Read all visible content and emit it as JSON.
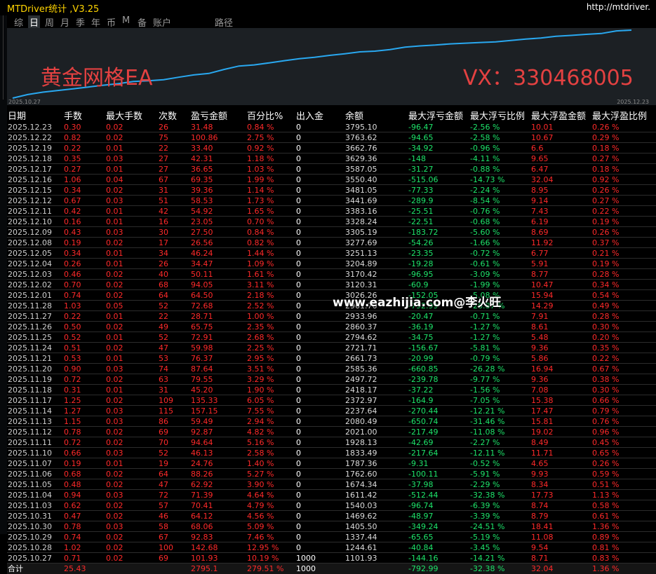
{
  "app": {
    "title": "MTDriver统计 ,V3.25",
    "url": "http://mtdriver."
  },
  "tabs": [
    "综",
    "日",
    "周",
    "月",
    "季",
    "年",
    "币",
    "M",
    "备",
    "账户",
    "路径"
  ],
  "active_tab": "日",
  "chart": {
    "watermark_left": "黄金网格EA",
    "watermark_right": "VX：330468005",
    "start_label": "2025.10.27",
    "end_label": "2025.12.23",
    "line_color": "#29a8f0",
    "equity": [
      1101.93,
      1244.61,
      1337.44,
      1405.5,
      1469.62,
      1540.03,
      1611.42,
      1674.34,
      1762.6,
      1787.36,
      1833.49,
      1928.13,
      2021.0,
      2080.49,
      2237.64,
      2372.97,
      2418.17,
      2497.72,
      2585.36,
      2661.73,
      2721.71,
      2794.62,
      2860.37,
      2933.96,
      2961.76,
      3026.26,
      3120.31,
      3170.42,
      3204.89,
      3251.13,
      3277.69,
      3305.19,
      3328.24,
      3383.16,
      3441.69,
      3481.05,
      3550.4,
      3587.05,
      3629.36,
      3662.76,
      3763.62,
      3795.1
    ]
  },
  "center_watermark": "www.eazhijia.com@李火旺",
  "table": {
    "headers": [
      "日期",
      "手数",
      "最大手数",
      "次数",
      "盈亏金额",
      "百分比%",
      "出入金",
      "余额",
      "最大浮亏金额",
      "最大浮亏比例",
      "最大浮盈金额",
      "最大浮盈比例"
    ],
    "rows": [
      [
        "2025.12.23",
        "0.30",
        "0.02",
        "26",
        "31.48",
        "0.84 %",
        "0",
        "3795.10",
        "-96.47",
        "-2.56 %",
        "10.01",
        "0.26 %"
      ],
      [
        "2025.12.22",
        "0.82",
        "0.02",
        "75",
        "100.86",
        "2.75 %",
        "0",
        "3763.62",
        "-94.65",
        "-2.58 %",
        "10.67",
        "0.29 %"
      ],
      [
        "2025.12.19",
        "0.22",
        "0.01",
        "22",
        "33.40",
        "0.92 %",
        "0",
        "3662.76",
        "-34.92",
        "-0.96 %",
        "6.6",
        "0.18 %"
      ],
      [
        "2025.12.18",
        "0.35",
        "0.03",
        "27",
        "42.31",
        "1.18 %",
        "0",
        "3629.36",
        "-148",
        "-4.11 %",
        "9.65",
        "0.27 %"
      ],
      [
        "2025.12.17",
        "0.27",
        "0.01",
        "27",
        "36.65",
        "1.03 %",
        "0",
        "3587.05",
        "-31.27",
        "-0.88 %",
        "6.47",
        "0.18 %"
      ],
      [
        "2025.12.16",
        "1.06",
        "0.04",
        "67",
        "69.35",
        "1.99 %",
        "0",
        "3550.40",
        "-515.06",
        "-14.73 %",
        "32.04",
        "0.92 %"
      ],
      [
        "2025.12.15",
        "0.34",
        "0.02",
        "31",
        "39.36",
        "1.14 %",
        "0",
        "3481.05",
        "-77.33",
        "-2.24 %",
        "8.95",
        "0.26 %"
      ],
      [
        "2025.12.12",
        "0.67",
        "0.03",
        "51",
        "58.53",
        "1.73 %",
        "0",
        "3441.69",
        "-289.9",
        "-8.54 %",
        "9.14",
        "0.27 %"
      ],
      [
        "2025.12.11",
        "0.42",
        "0.01",
        "42",
        "54.92",
        "1.65 %",
        "0",
        "3383.16",
        "-25.51",
        "-0.76 %",
        "7.43",
        "0.22 %"
      ],
      [
        "2025.12.10",
        "0.16",
        "0.01",
        "16",
        "23.05",
        "0.70 %",
        "0",
        "3328.24",
        "-22.51",
        "-0.68 %",
        "6.19",
        "0.19 %"
      ],
      [
        "2025.12.09",
        "0.43",
        "0.03",
        "30",
        "27.50",
        "0.84 %",
        "0",
        "3305.19",
        "-183.72",
        "-5.60 %",
        "8.69",
        "0.26 %"
      ],
      [
        "2025.12.08",
        "0.19",
        "0.02",
        "17",
        "26.56",
        "0.82 %",
        "0",
        "3277.69",
        "-54.26",
        "-1.66 %",
        "11.92",
        "0.37 %"
      ],
      [
        "2025.12.05",
        "0.34",
        "0.01",
        "34",
        "46.24",
        "1.44 %",
        "0",
        "3251.13",
        "-23.35",
        "-0.72 %",
        "6.77",
        "0.21 %"
      ],
      [
        "2025.12.04",
        "0.26",
        "0.01",
        "26",
        "34.47",
        "1.09 %",
        "0",
        "3204.89",
        "-19.28",
        "-0.61 %",
        "5.91",
        "0.19 %"
      ],
      [
        "2025.12.03",
        "0.46",
        "0.02",
        "40",
        "50.11",
        "1.61 %",
        "0",
        "3170.42",
        "-96.95",
        "-3.09 %",
        "8.77",
        "0.28 %"
      ],
      [
        "2025.12.02",
        "0.70",
        "0.02",
        "68",
        "94.05",
        "3.11 %",
        "0",
        "3120.31",
        "-60.9",
        "-1.99 %",
        "10.47",
        "0.34 %"
      ],
      [
        "2025.12.01",
        "0.74",
        "0.02",
        "64",
        "64.50",
        "2.18 %",
        "0",
        "3026.26",
        "-152.05",
        "-5.08 %",
        "15.94",
        "0.54 %"
      ],
      [
        "2025.11.28",
        "1.03",
        "0.05",
        "52",
        "72.68",
        "2.52 %",
        "0",
        "2961.76",
        "-792.99",
        "-26.87 %",
        "14.29",
        "0.49 %"
      ],
      [
        "2025.11.27",
        "0.22",
        "0.01",
        "22",
        "28.71",
        "1.00 %",
        "0",
        "2933.96",
        "-20.47",
        "-0.71 %",
        "7.91",
        "0.28 %"
      ],
      [
        "2025.11.26",
        "0.50",
        "0.02",
        "49",
        "65.75",
        "2.35 %",
        "0",
        "2860.37",
        "-36.19",
        "-1.27 %",
        "8.61",
        "0.30 %"
      ],
      [
        "2025.11.25",
        "0.52",
        "0.01",
        "52",
        "72.91",
        "2.68 %",
        "0",
        "2794.62",
        "-34.75",
        "-1.27 %",
        "5.48",
        "0.20 %"
      ],
      [
        "2025.11.24",
        "0.51",
        "0.02",
        "47",
        "59.98",
        "2.25 %",
        "0",
        "2721.71",
        "-156.67",
        "-5.81 %",
        "9.36",
        "0.35 %"
      ],
      [
        "2025.11.21",
        "0.53",
        "0.01",
        "53",
        "76.37",
        "2.95 %",
        "0",
        "2661.73",
        "-20.99",
        "-0.79 %",
        "5.86",
        "0.22 %"
      ],
      [
        "2025.11.20",
        "0.90",
        "0.03",
        "74",
        "87.64",
        "3.51 %",
        "0",
        "2585.36",
        "-660.85",
        "-26.28 %",
        "16.94",
        "0.67 %"
      ],
      [
        "2025.11.19",
        "0.72",
        "0.02",
        "63",
        "79.55",
        "3.29 %",
        "0",
        "2497.72",
        "-239.78",
        "-9.77 %",
        "9.36",
        "0.38 %"
      ],
      [
        "2025.11.18",
        "0.31",
        "0.01",
        "31",
        "45.20",
        "1.90 %",
        "0",
        "2418.17",
        "-37.22",
        "-1.56 %",
        "7.08",
        "0.30 %"
      ],
      [
        "2025.11.17",
        "1.25",
        "0.02",
        "109",
        "135.33",
        "6.05 %",
        "0",
        "2372.97",
        "-164.9",
        "-7.05 %",
        "15.38",
        "0.66 %"
      ],
      [
        "2025.11.14",
        "1.27",
        "0.03",
        "115",
        "157.15",
        "7.55 %",
        "0",
        "2237.64",
        "-270.44",
        "-12.21 %",
        "17.47",
        "0.79 %"
      ],
      [
        "2025.11.13",
        "1.15",
        "0.03",
        "86",
        "59.49",
        "2.94 %",
        "0",
        "2080.49",
        "-650.74",
        "-31.46 %",
        "15.81",
        "0.76 %"
      ],
      [
        "2025.11.12",
        "0.78",
        "0.02",
        "69",
        "92.87",
        "4.82 %",
        "0",
        "2021.00",
        "-217.49",
        "-11.08 %",
        "19.02",
        "0.96 %"
      ],
      [
        "2025.11.11",
        "0.72",
        "0.02",
        "70",
        "94.64",
        "5.16 %",
        "0",
        "1928.13",
        "-42.69",
        "-2.27 %",
        "8.49",
        "0.45 %"
      ],
      [
        "2025.11.10",
        "0.66",
        "0.03",
        "52",
        "46.13",
        "2.58 %",
        "0",
        "1833.49",
        "-217.64",
        "-12.11 %",
        "11.71",
        "0.65 %"
      ],
      [
        "2025.11.07",
        "0.19",
        "0.01",
        "19",
        "24.76",
        "1.40 %",
        "0",
        "1787.36",
        "-9.31",
        "-0.52 %",
        "4.65",
        "0.26 %"
      ],
      [
        "2025.11.06",
        "0.68",
        "0.02",
        "64",
        "88.26",
        "5.27 %",
        "0",
        "1762.60",
        "-100.11",
        "-5.91 %",
        "9.93",
        "0.59 %"
      ],
      [
        "2025.11.05",
        "0.48",
        "0.02",
        "47",
        "62.92",
        "3.90 %",
        "0",
        "1674.34",
        "-37.98",
        "-2.29 %",
        "8.34",
        "0.51 %"
      ],
      [
        "2025.11.04",
        "0.94",
        "0.03",
        "72",
        "71.39",
        "4.64 %",
        "0",
        "1611.42",
        "-512.44",
        "-32.38 %",
        "17.73",
        "1.13 %"
      ],
      [
        "2025.11.03",
        "0.62",
        "0.02",
        "57",
        "70.41",
        "4.79 %",
        "0",
        "1540.03",
        "-96.74",
        "-6.39 %",
        "8.74",
        "0.58 %"
      ],
      [
        "2025.10.31",
        "0.47",
        "0.02",
        "46",
        "64.12",
        "4.56 %",
        "0",
        "1469.62",
        "-48.97",
        "-3.39 %",
        "8.79",
        "0.61 %"
      ],
      [
        "2025.10.30",
        "0.78",
        "0.03",
        "58",
        "68.06",
        "5.09 %",
        "0",
        "1405.50",
        "-349.24",
        "-24.51 %",
        "18.41",
        "1.36 %"
      ],
      [
        "2025.10.29",
        "0.74",
        "0.02",
        "67",
        "92.83",
        "7.46 %",
        "0",
        "1337.44",
        "-65.65",
        "-5.19 %",
        "11.08",
        "0.89 %"
      ],
      [
        "2025.10.28",
        "1.02",
        "0.02",
        "100",
        "142.68",
        "12.95 %",
        "0",
        "1244.61",
        "-40.84",
        "-3.45 %",
        "9.54",
        "0.81 %"
      ],
      [
        "2025.10.27",
        "0.71",
        "0.02",
        "69",
        "101.93",
        "10.19 %",
        "1000",
        "1101.93",
        "-144.16",
        "-14.21 %",
        "8.71",
        "0.83 %"
      ]
    ],
    "total": [
      "合计",
      "25.43",
      "",
      "",
      "2795.1",
      "279.51 %",
      "1000",
      "",
      "-792.99",
      "-32.38 %",
      "32.04",
      "1.36 %"
    ]
  }
}
